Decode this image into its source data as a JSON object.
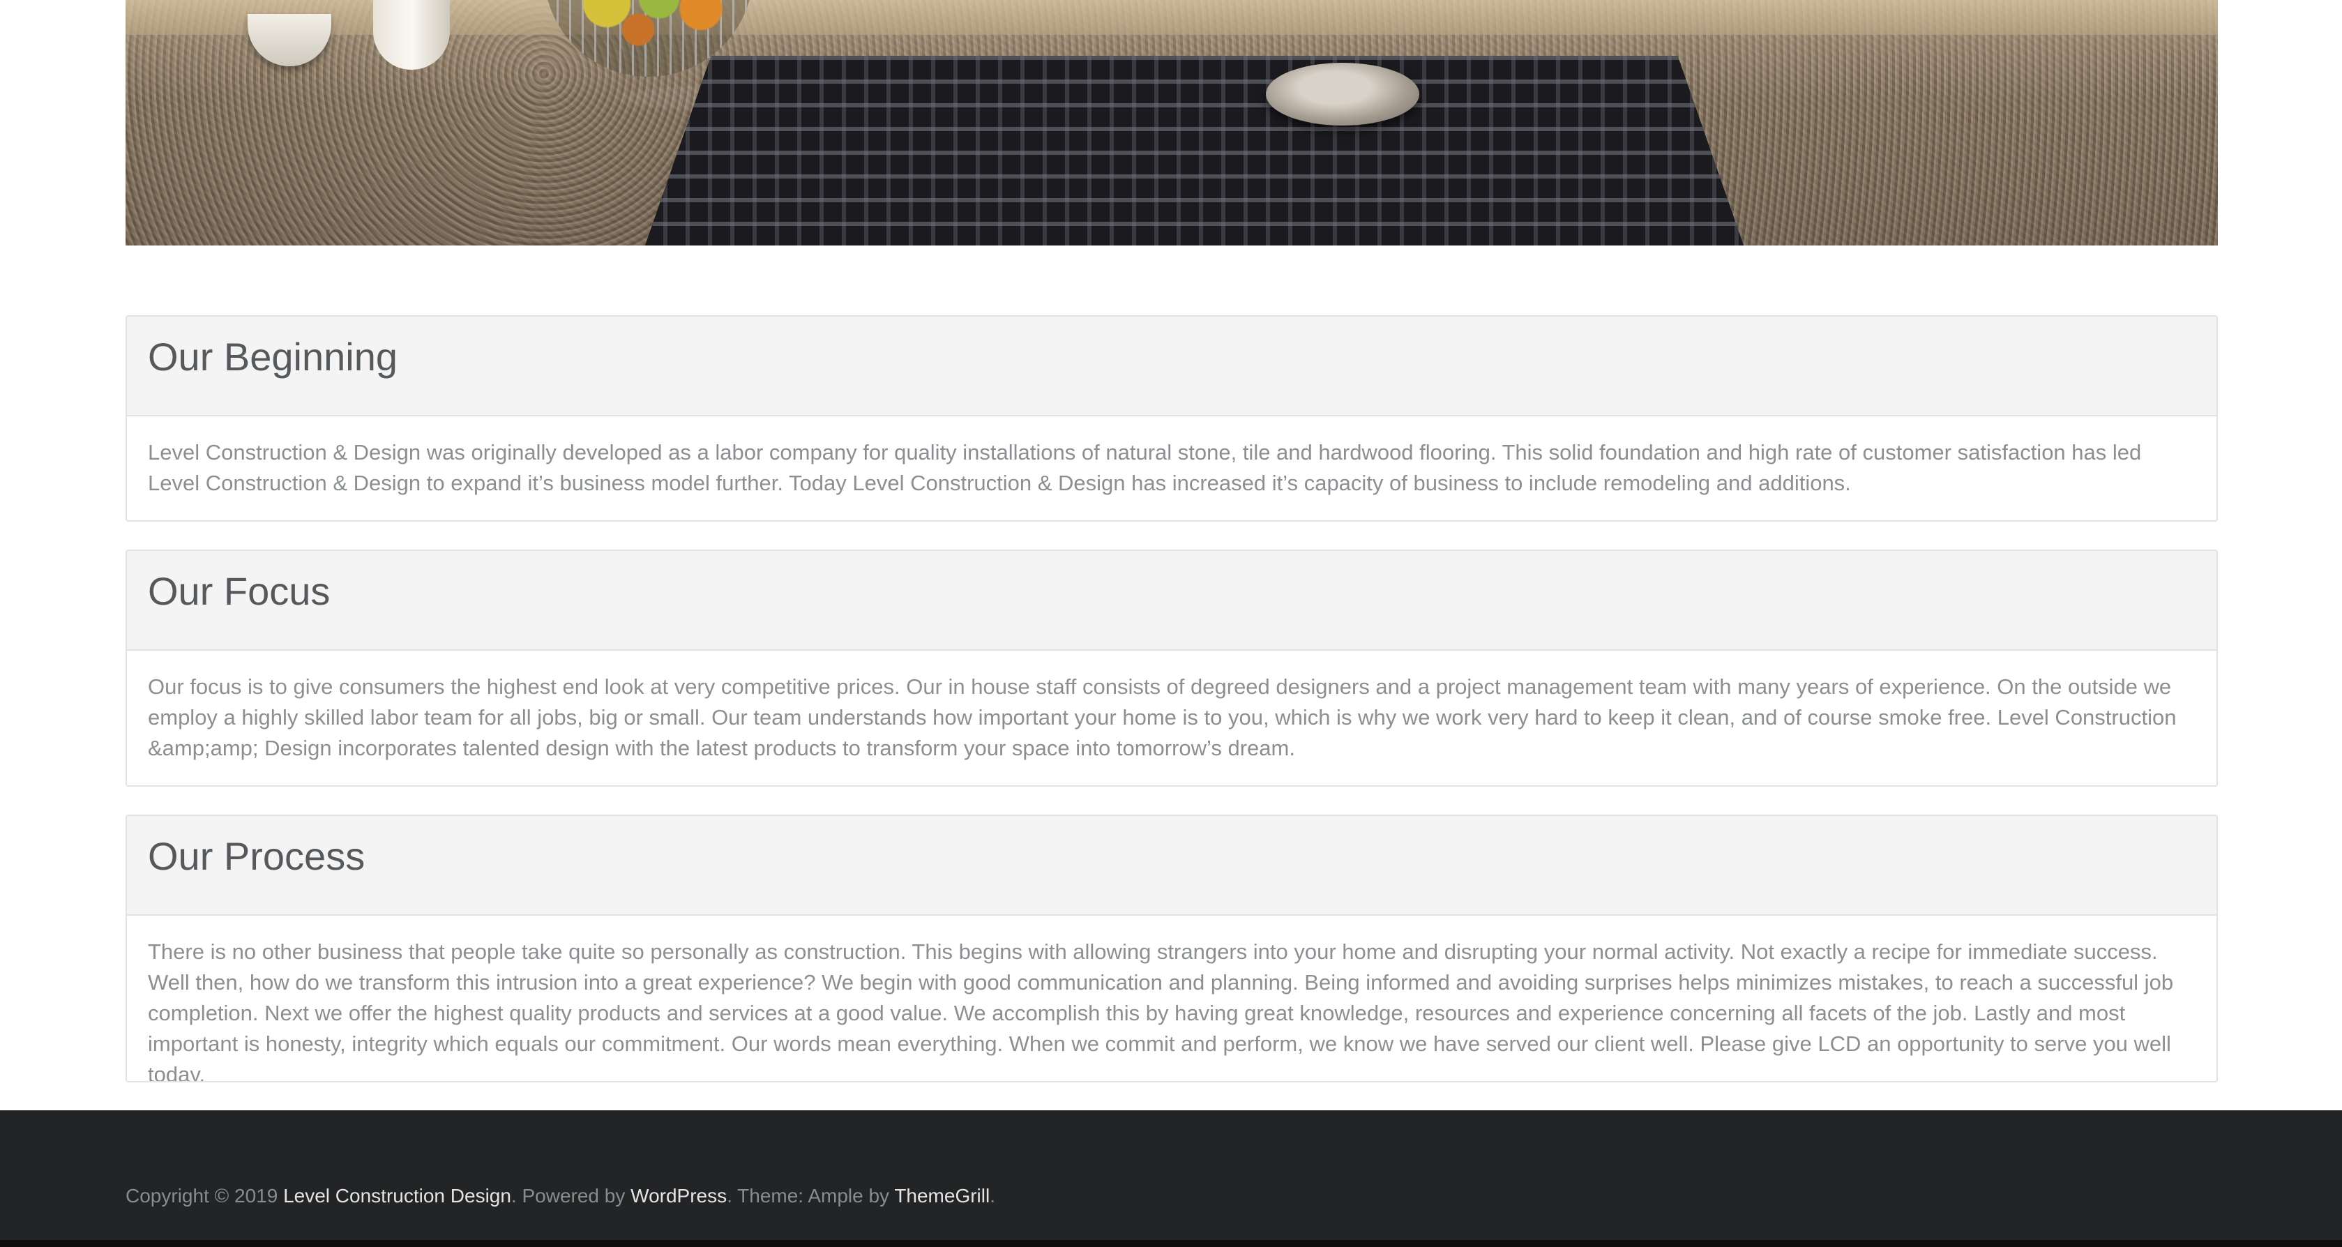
{
  "hero": {
    "image_alt": "Kitchen stove on granite countertop"
  },
  "sections": [
    {
      "title": "Our Beginning",
      "body": "Level Construction & Design was originally developed as a labor company for quality installations of natural stone, tile and hardwood flooring. This solid foundation and high rate of customer satisfaction has led Level Construction & Design to expand it’s business model further. Today Level Construction & Design has increased it’s capacity of business to include remodeling and additions."
    },
    {
      "title": "Our Focus",
      "body": "Our focus is to give consumers the highest end look at very competitive prices. Our in house staff consists of degreed designers and a project management team with many years of experience. On the outside we employ a highly skilled labor team for all jobs, big or small. Our team understands how important your home is to you, which is why we work very hard to keep it clean, and of course smoke free. Level Construction &amp;amp; Design incorporates talented design with the latest products to transform your space into tomorrow’s dream."
    },
    {
      "title": "Our Process",
      "body": "There is no other business that people take quite so personally as construction. This begins with allowing strangers into your home and disrupting your normal activity. Not exactly a recipe for immediate success. Well then, how do we transform this intrusion into a great experience? We begin with good communication and planning. Being informed and avoiding surprises helps minimizes mistakes, to reach a successful job completion. Next we offer the highest quality products and services at a good value. We accomplish this by having great knowledge, resources and experience concerning all facets of the job. Lastly and most important is honesty, integrity which equals our commitment. Our words mean everything. When we commit and perform, we know we have served our client well. Please give LCD an opportunity to serve you well today."
    }
  ],
  "footer": {
    "copyright_prefix": "Copyright © 2019 ",
    "site_link": "Level Construction Design",
    "powered_by_text": ". Powered by ",
    "wordpress_link": "WordPress",
    "theme_text": ". Theme: Ample by ",
    "themegrill_link": "ThemeGrill",
    "end_text": "."
  },
  "colors": {
    "footer_bg": "#232425",
    "panel_heading_bg": "#f4f4f4",
    "body_text": "#8c8f92",
    "heading_text": "#55595c"
  }
}
